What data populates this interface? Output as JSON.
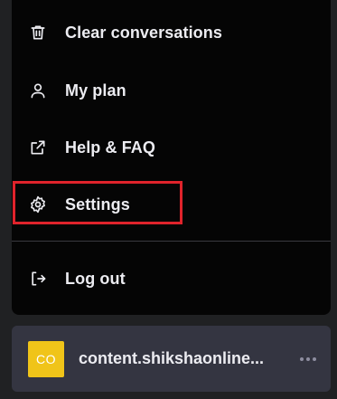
{
  "menu": {
    "items": [
      {
        "label": "Clear conversations",
        "icon": "trash-icon"
      },
      {
        "label": "My plan",
        "icon": "user-icon"
      },
      {
        "label": "Help & FAQ",
        "icon": "external-link-icon"
      },
      {
        "label": "Settings",
        "icon": "gear-icon"
      },
      {
        "label": "Log out",
        "icon": "logout-icon"
      }
    ]
  },
  "account": {
    "avatar_initials": "CO",
    "name": "content.shikshaonline..."
  },
  "colors": {
    "menu_bg": "#050505",
    "account_bg": "#343541",
    "avatar_bg": "#f0c419",
    "highlight": "#e0232b",
    "text": "#ececf1"
  }
}
